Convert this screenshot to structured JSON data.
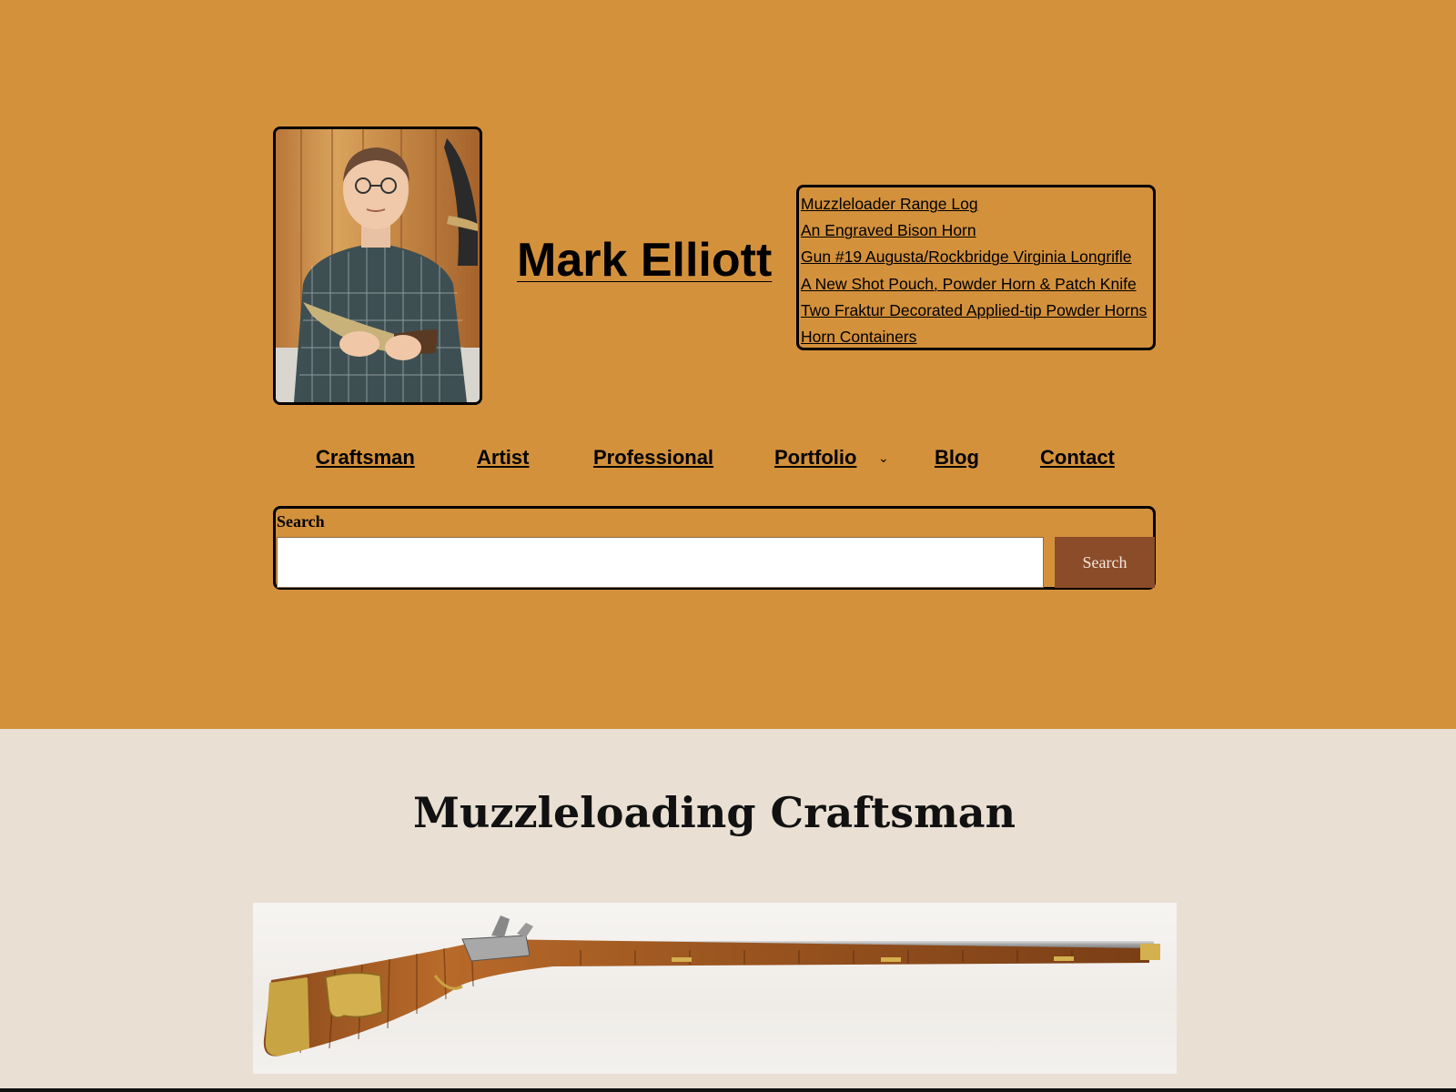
{
  "site": {
    "title": "Mark Elliott",
    "portrait_alt": "Mark Elliott holding an engraved powder horn"
  },
  "recent_posts": [
    "Muzzleloader Range Log",
    "An Engraved Bison Horn",
    "Gun #19 Augusta/Rockbridge Virginia Longrifle",
    "A New Shot Pouch, Powder Horn & Patch Knife",
    "Two Fraktur Decorated Applied-tip Powder Horns",
    "Horn Containers"
  ],
  "nav": {
    "craftsman": "Craftsman",
    "artist": "Artist",
    "professional": "Professional",
    "portfolio": "Portfolio",
    "portfolio_chevron": "⌄",
    "blog": "Blog",
    "contact": "Contact"
  },
  "search": {
    "label": "Search",
    "value": "",
    "button": "Search"
  },
  "main": {
    "title": "Muzzleloading Craftsman",
    "image_alt": "Flintlock longrifle with curly maple stock and brass patchbox"
  },
  "colors": {
    "header_bg": "#d4913c",
    "page_bg": "#e9dfd3",
    "button_bg": "#8b4c2a"
  }
}
